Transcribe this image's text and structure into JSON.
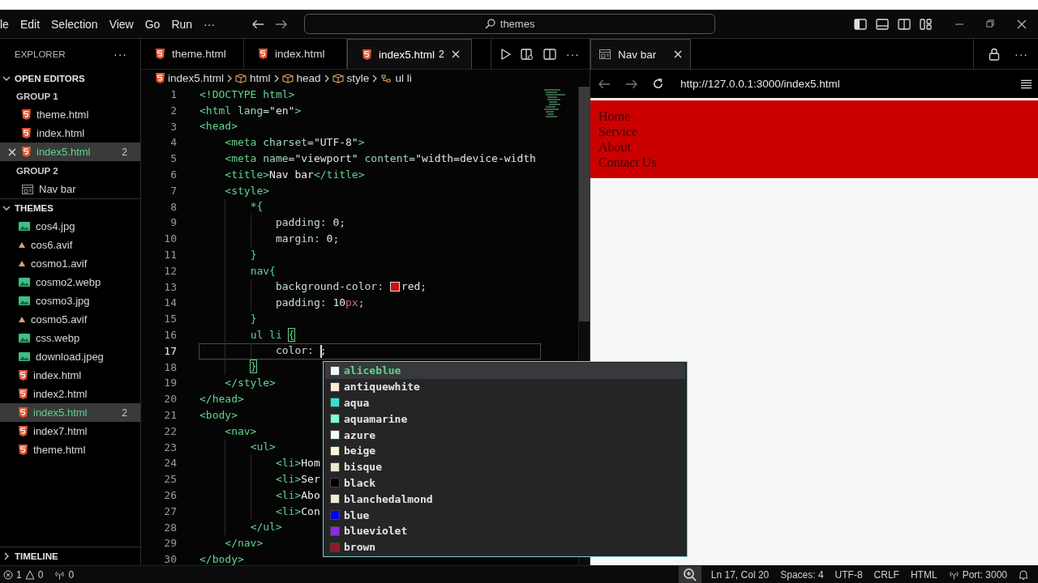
{
  "title_bar": {
    "menu": [
      "le",
      "Edit",
      "Selection",
      "View",
      "Go",
      "Run",
      "···"
    ],
    "search": "themes"
  },
  "sidebar": {
    "title": "EXPLORER",
    "more": "···",
    "open_editors": {
      "label": "OPEN EDITORS",
      "expanded": true,
      "groups": [
        {
          "label": "GROUP 1",
          "children": [
            {
              "name": "theme.html",
              "kind": "html",
              "selected": false
            },
            {
              "name": "index.html",
              "kind": "html",
              "selected": false
            },
            {
              "name": "index5.html",
              "kind": "html",
              "badge": "2",
              "selected": true
            }
          ]
        },
        {
          "label": "GROUP 2",
          "children": [
            {
              "name": "Nav bar",
              "kind": "preview",
              "selected": false
            }
          ]
        }
      ]
    },
    "folder": {
      "label": "THEMES",
      "expanded": true,
      "children": [
        {
          "name": "cos4.jpg",
          "kind": "image",
          "selected": false
        },
        {
          "name": "cos6.avif",
          "kind": "avif",
          "selected": false
        },
        {
          "name": "cosmo1.avif",
          "kind": "avif",
          "selected": false
        },
        {
          "name": "cosmo2.webp",
          "kind": "image",
          "selected": false
        },
        {
          "name": "cosmo3.jpg",
          "kind": "image",
          "selected": false
        },
        {
          "name": "cosmo5.avif",
          "kind": "avif",
          "selected": false
        },
        {
          "name": "css.webp",
          "kind": "image",
          "selected": false
        },
        {
          "name": "download.jpeg",
          "kind": "image",
          "selected": false
        },
        {
          "name": "index.html",
          "kind": "html",
          "selected": false
        },
        {
          "name": "index2.html",
          "kind": "html",
          "selected": false
        },
        {
          "name": "index5.html",
          "kind": "html",
          "badge": "2",
          "selected": true
        },
        {
          "name": "index7.html",
          "kind": "html",
          "selected": false
        },
        {
          "name": "theme.html",
          "kind": "html",
          "selected": false
        }
      ]
    },
    "timeline": {
      "label": "TIMELINE",
      "expanded": false
    }
  },
  "editor": {
    "tabs": [
      {
        "label": "theme.html",
        "selected": false
      },
      {
        "label": "index.html",
        "selected": false
      },
      {
        "label": "index5.html",
        "badge": "2",
        "selected": true
      }
    ],
    "more": "···",
    "breadcrumbs": [
      {
        "label": "index5.html",
        "kind": "html"
      },
      {
        "label": "html",
        "kind": "element"
      },
      {
        "label": "head",
        "kind": "element"
      },
      {
        "label": "style",
        "kind": "element"
      },
      {
        "label": "ul li",
        "kind": "selector"
      }
    ],
    "lines": [
      {
        "number": "1",
        "current": false,
        "tokens": [
          {
            "kind": "tag",
            "text": "<!DOCTYPE html>"
          }
        ]
      },
      {
        "number": "2",
        "current": false,
        "tokens": [
          {
            "kind": "tag",
            "text": "<html"
          },
          {
            "kind": "attr",
            "text": " lang"
          },
          {
            "kind": "punct",
            "text": "="
          },
          {
            "kind": "string",
            "text": "\"en\""
          },
          {
            "kind": "tag",
            "text": ">"
          }
        ]
      },
      {
        "number": "3",
        "current": false,
        "tokens": [
          {
            "kind": "tag",
            "text": "<head>"
          }
        ]
      },
      {
        "number": "4",
        "current": false,
        "tokens": [
          {
            "kind": "tag",
            "text": "    <meta"
          },
          {
            "kind": "attr",
            "text": " charset"
          },
          {
            "kind": "punct",
            "text": "="
          },
          {
            "kind": "string",
            "text": "\"UTF-8\""
          },
          {
            "kind": "tag",
            "text": ">"
          }
        ]
      },
      {
        "number": "5",
        "current": false,
        "tokens": [
          {
            "kind": "tag",
            "text": "    <meta"
          },
          {
            "kind": "attr",
            "text": " name"
          },
          {
            "kind": "punct",
            "text": "="
          },
          {
            "kind": "string",
            "text": "\"viewport\""
          },
          {
            "kind": "attr",
            "text": " content"
          },
          {
            "kind": "punct",
            "text": "="
          },
          {
            "kind": "string",
            "text": "\"width=device-width"
          }
        ]
      },
      {
        "number": "6",
        "current": false,
        "tokens": [
          {
            "kind": "tag",
            "text": "    <title>"
          },
          {
            "kind": "text",
            "text": "Nav bar"
          },
          {
            "kind": "tag",
            "text": "</title>"
          }
        ]
      },
      {
        "number": "7",
        "current": false,
        "tokens": [
          {
            "kind": "tag",
            "text": "    <style>"
          }
        ]
      },
      {
        "number": "8",
        "current": false,
        "tokens": [
          {
            "kind": "selector",
            "text": "        *{"
          }
        ]
      },
      {
        "number": "9",
        "current": false,
        "tokens": [
          {
            "kind": "prop",
            "text": "            padding"
          },
          {
            "kind": "punct",
            "text": ": "
          },
          {
            "kind": "number",
            "text": "0"
          },
          {
            "kind": "punct",
            "text": ";"
          }
        ]
      },
      {
        "number": "10",
        "current": false,
        "tokens": [
          {
            "kind": "prop",
            "text": "            margin"
          },
          {
            "kind": "punct",
            "text": ": "
          },
          {
            "kind": "number",
            "text": "0"
          },
          {
            "kind": "punct",
            "text": ";"
          }
        ]
      },
      {
        "number": "11",
        "current": false,
        "tokens": [
          {
            "kind": "selector",
            "text": "        }"
          }
        ]
      },
      {
        "number": "12",
        "current": false,
        "tokens": [
          {
            "kind": "selector",
            "text": "        nav{"
          }
        ]
      },
      {
        "number": "13",
        "current": false,
        "tokens": [
          {
            "kind": "prop",
            "text": "            background-color"
          },
          {
            "kind": "punct",
            "text": ": "
          },
          {
            "kind": "swatch",
            "color": "#cc1111"
          },
          {
            "kind": "string",
            "text": "red"
          },
          {
            "kind": "punct",
            "text": ";"
          }
        ]
      },
      {
        "number": "14",
        "current": false,
        "tokens": [
          {
            "kind": "prop",
            "text": "            padding"
          },
          {
            "kind": "punct",
            "text": ": "
          },
          {
            "kind": "number",
            "text": "10"
          },
          {
            "kind": "unit",
            "text": "px"
          },
          {
            "kind": "punct",
            "text": ";"
          }
        ]
      },
      {
        "number": "15",
        "current": false,
        "tokens": [
          {
            "kind": "selector",
            "text": "        }"
          }
        ]
      },
      {
        "number": "16",
        "current": false,
        "tokens": [
          {
            "kind": "selector",
            "text": "        ul li "
          },
          {
            "kind": "brace",
            "text": "{"
          }
        ]
      },
      {
        "number": "17",
        "current": true,
        "tokens": [
          {
            "kind": "prop",
            "text": "            color"
          },
          {
            "kind": "punct",
            "text": ": "
          },
          {
            "kind": "cursor"
          },
          {
            "kind": "punct",
            "text": ";"
          }
        ]
      },
      {
        "number": "18",
        "current": false,
        "tokens": [
          {
            "kind": "brace",
            "text": "        }"
          }
        ]
      },
      {
        "number": "19",
        "current": false,
        "tokens": [
          {
            "kind": "tag",
            "text": "    </style>"
          }
        ]
      },
      {
        "number": "20",
        "current": false,
        "tokens": [
          {
            "kind": "tag",
            "text": "</head>"
          }
        ]
      },
      {
        "number": "21",
        "current": false,
        "tokens": [
          {
            "kind": "tag",
            "text": "<body>"
          }
        ]
      },
      {
        "number": "22",
        "current": false,
        "tokens": [
          {
            "kind": "tag",
            "text": "    <nav>"
          }
        ]
      },
      {
        "number": "23",
        "current": false,
        "tokens": [
          {
            "kind": "tag",
            "text": "        <ul>"
          }
        ]
      },
      {
        "number": "24",
        "current": false,
        "tokens": [
          {
            "kind": "tag",
            "text": "            <li>"
          },
          {
            "kind": "text",
            "text": "Hom"
          }
        ]
      },
      {
        "number": "25",
        "current": false,
        "tokens": [
          {
            "kind": "tag",
            "text": "            <li>"
          },
          {
            "kind": "text",
            "text": "Ser"
          }
        ]
      },
      {
        "number": "26",
        "current": false,
        "tokens": [
          {
            "kind": "tag",
            "text": "            <li>"
          },
          {
            "kind": "text",
            "text": "Abo"
          }
        ]
      },
      {
        "number": "27",
        "current": false,
        "tokens": [
          {
            "kind": "tag",
            "text": "            <li>"
          },
          {
            "kind": "text",
            "text": "Con"
          }
        ]
      },
      {
        "number": "28",
        "current": false,
        "tokens": [
          {
            "kind": "tag",
            "text": "        </ul>"
          }
        ]
      },
      {
        "number": "29",
        "current": false,
        "tokens": [
          {
            "kind": "tag",
            "text": "    </nav>"
          }
        ]
      },
      {
        "number": "30",
        "current": false,
        "tokens": [
          {
            "kind": "tag",
            "text": "</body>"
          }
        ]
      }
    ]
  },
  "autocomplete": [
    {
      "label": "aliceblue",
      "color": "#f0f8ff",
      "selected": true
    },
    {
      "label": "antiquewhite",
      "color": "#faebd7",
      "selected": false
    },
    {
      "label": "aqua",
      "color": "#2fe3cf",
      "selected": false
    },
    {
      "label": "aquamarine",
      "color": "#7fffd4",
      "selected": false
    },
    {
      "label": "azure",
      "color": "#f0ffff",
      "selected": false
    },
    {
      "label": "beige",
      "color": "#f5f5dc",
      "selected": false
    },
    {
      "label": "bisque",
      "color": "#eee4d2",
      "selected": false
    },
    {
      "label": "black",
      "color": "#000000",
      "selected": false
    },
    {
      "label": "blanchedalmond",
      "color": "#f3ead6",
      "selected": false
    },
    {
      "label": "blue",
      "color": "#0000ff",
      "selected": false
    },
    {
      "label": "blueviolet",
      "color": "#8a2be2",
      "selected": false
    },
    {
      "label": "brown",
      "color": "#8b1a2a",
      "selected": false
    }
  ],
  "preview": {
    "tab": "Nav bar",
    "more": "···",
    "url": "http://127.0.0.1:3000/index5.html",
    "nav_items": [
      "Home",
      "Service",
      "About",
      "Contact Us"
    ]
  },
  "status_bar": {
    "errors": "1",
    "warnings": "0",
    "ports": "0",
    "items": [
      "Ln 17, Col 20",
      "Spaces: 4",
      "UTF-8",
      "CRLF",
      "HTML"
    ],
    "port": "Port: 3000"
  }
}
